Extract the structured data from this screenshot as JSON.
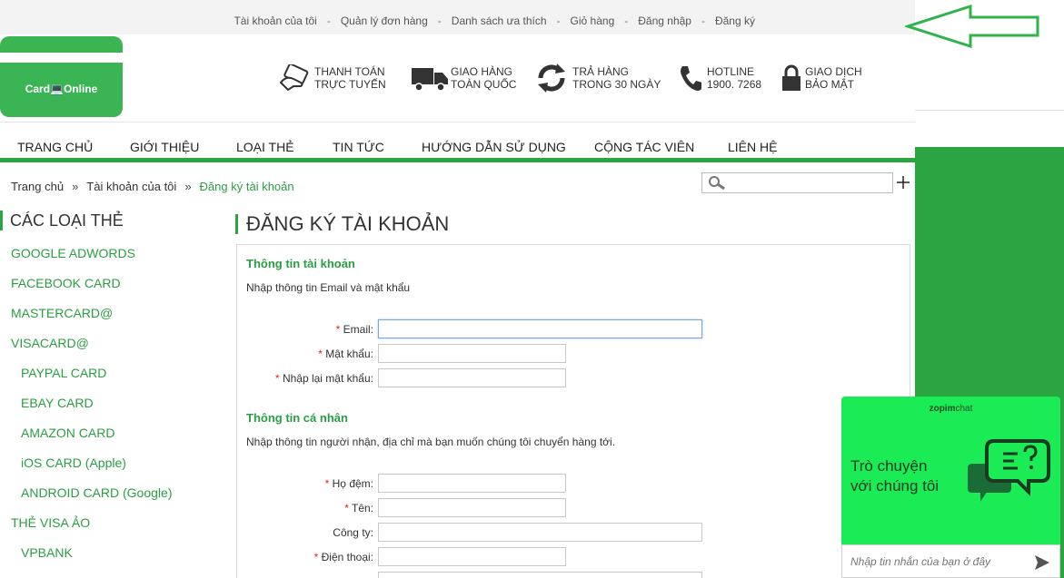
{
  "top_links": [
    "Tài khoản của tôi",
    "Quản lý đơn hàng",
    "Danh sách ưa thích",
    "Giỏ hàng",
    "Đăng nhập",
    "Đăng ký"
  ],
  "top_link_separator": "-",
  "logo": {
    "text": "Card💻Online"
  },
  "features": [
    {
      "icon": "card-payment-icon",
      "line1": "THANH TOÁN",
      "line2": "TRỰC TUYẾN"
    },
    {
      "icon": "delivery-truck-icon",
      "line1": "GIAO HÀNG",
      "line2": "TOÀN QUỐC"
    },
    {
      "icon": "return-arrows-icon",
      "line1": "TRẢ HÀNG",
      "line2": "TRONG 30 NGÀY"
    },
    {
      "icon": "phone-icon",
      "line1": "HOTLINE",
      "line2": "1900. 7268"
    },
    {
      "icon": "padlock-icon",
      "line1": "GIAO DỊCH",
      "line2": "BẢO MẬT"
    }
  ],
  "nav": [
    "TRANG CHỦ",
    "GIỚI THIỆU",
    "LOẠI THẺ",
    "TIN TỨC",
    "HƯỚNG DẪN SỬ DỤNG",
    "CỘNG TÁC VIÊN",
    "LIÊN HỆ"
  ],
  "breadcrumb": {
    "items": [
      "Trang chủ",
      "Tài khoản của tôi",
      "Đăng ký tài khoản"
    ],
    "separator": "»"
  },
  "sidebar": {
    "title": "CÁC LOẠI THẺ",
    "items": [
      {
        "label": "GOOGLE ADWORDS",
        "level": 0
      },
      {
        "label": "FACEBOOK CARD",
        "level": 0
      },
      {
        "label": "MASTERCARD@",
        "level": 0
      },
      {
        "label": "VISACARD@",
        "level": 0
      },
      {
        "label": "PAYPAL CARD",
        "level": 1
      },
      {
        "label": "EBAY CARD",
        "level": 1
      },
      {
        "label": "AMAZON CARD",
        "level": 1
      },
      {
        "label": "iOS CARD (Apple)",
        "level": 1
      },
      {
        "label": "ANDROID CARD (Google)",
        "level": 1
      },
      {
        "label": "THẺ VISA ẢO",
        "level": 0
      },
      {
        "label": "VPBANK",
        "level": 1
      }
    ]
  },
  "page_title": "ĐĂNG KÝ TÀI KHOẢN",
  "form": {
    "required_mark": "*",
    "account_section": {
      "title": "Thông tin tài khoản",
      "desc": "Nhập thông tin Email và mật khẩu",
      "fields": [
        {
          "label": "Email:",
          "required": true,
          "value": ""
        },
        {
          "label": "Mật khẩu:",
          "required": true,
          "value": ""
        },
        {
          "label": "Nhập lại mật khẩu:",
          "required": true,
          "value": ""
        }
      ]
    },
    "personal_section": {
      "title": "Thông tin cá nhân",
      "desc": "Nhập thông tin người nhận, địa chỉ mà bạn muốn chúng tôi chuyển hàng tới.",
      "fields": [
        {
          "label": "Họ đệm:",
          "required": true,
          "value": ""
        },
        {
          "label": "Tên:",
          "required": true,
          "value": ""
        },
        {
          "label": "Công ty:",
          "required": false,
          "value": ""
        },
        {
          "label": "Điện thoại:",
          "required": true,
          "value": ""
        }
      ]
    }
  },
  "chat": {
    "brand_bold": "zopim",
    "brand_thin": "chat",
    "message_line1": "Trò chuyện",
    "message_line2": "với chúng tôi",
    "input_placeholder": "Nhập tin nhắn của bạn ở đây"
  },
  "colors": {
    "brand_green": "#2aa542",
    "link_green": "#2a9e43",
    "chat_green": "#1bec55",
    "required_red": "#e0271a",
    "annotation_arrow": "#2fb34a"
  }
}
